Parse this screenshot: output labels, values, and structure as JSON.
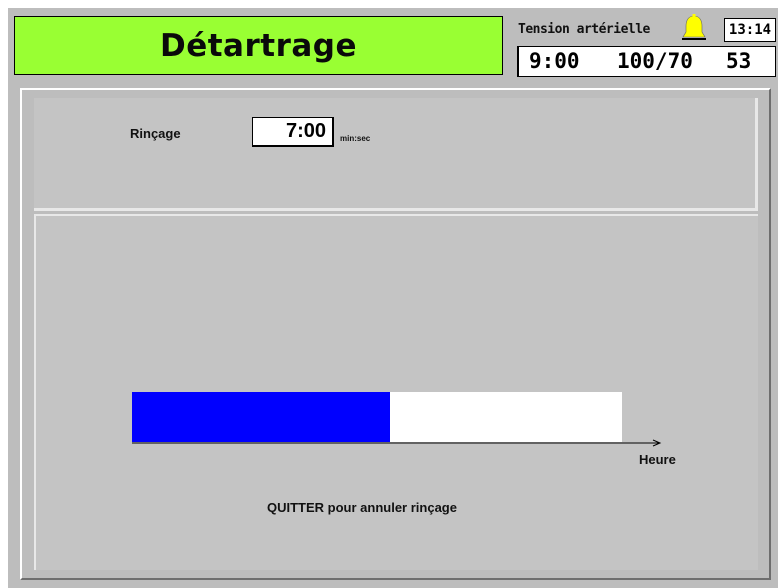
{
  "header": {
    "title": "Détartrage",
    "title_color": "#99ff33",
    "bp_label": "Tension artérielle",
    "clock": "13:14",
    "alarm_icon": "bell-icon",
    "alarm_color": "#ffff00",
    "bp_time": "9:00",
    "bp_value": "100/70",
    "bp_pulse": "53"
  },
  "rinse": {
    "label": "Rinçage",
    "value": "7:00",
    "unit": "min:sec"
  },
  "progress": {
    "fraction": 0.526,
    "fill_color": "#0000ff",
    "axis_label": "Heure"
  },
  "footer": {
    "quit_text": "QUITTER pour annuler rinçage"
  }
}
